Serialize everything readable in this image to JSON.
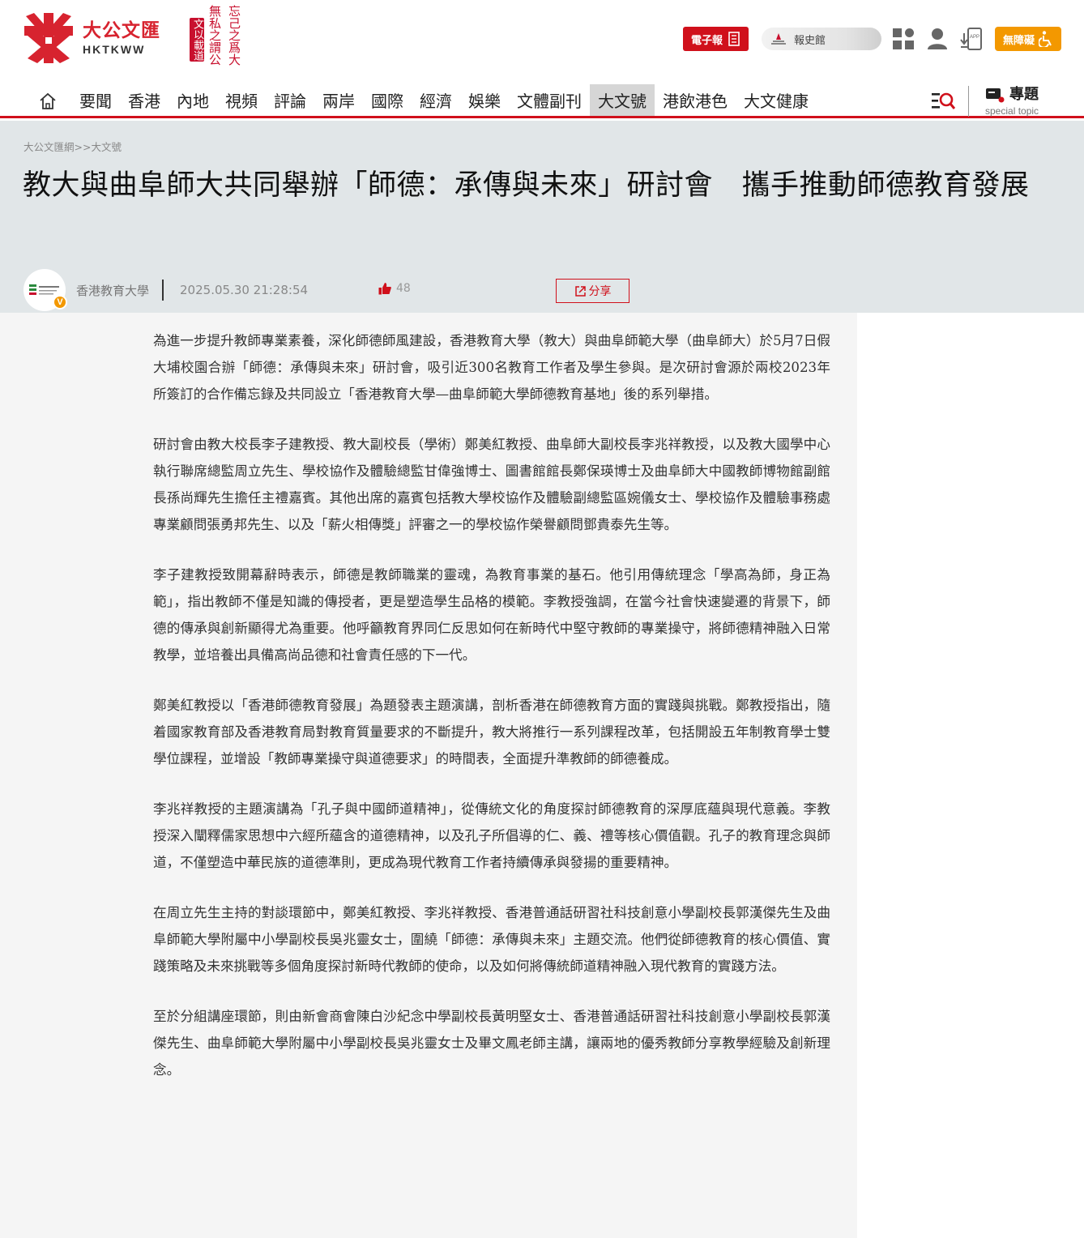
{
  "header": {
    "logo_cn": "大公文匯",
    "logo_en": "HKTKWW",
    "calligraphy": [
      "忘己之爲大",
      "無私之謂公",
      "文以載道"
    ],
    "epaper_label": "電子報",
    "archive_label": "報史館",
    "accessibility_label": "無障礙"
  },
  "nav": {
    "items": [
      {
        "label": "要聞",
        "active": false
      },
      {
        "label": "香港",
        "active": false
      },
      {
        "label": "內地",
        "active": false
      },
      {
        "label": "視頻",
        "active": false
      },
      {
        "label": "評論",
        "active": false
      },
      {
        "label": "兩岸",
        "active": false
      },
      {
        "label": "國際",
        "active": false
      },
      {
        "label": "經濟",
        "active": false
      },
      {
        "label": "娛樂",
        "active": false
      },
      {
        "label": "文體副刊",
        "active": false
      },
      {
        "label": "大文號",
        "active": true
      },
      {
        "label": "港飲港色",
        "active": false
      },
      {
        "label": "大文健康",
        "active": false
      }
    ],
    "topic_label": "專題",
    "topic_sub": "special topic"
  },
  "article": {
    "breadcrumb": "大公文匯網>>大文號",
    "title": "教大與曲阜師大共同舉辦「師德：承傳與未來」研討會　攜手推動師德教育發展",
    "author": "香港教育大學",
    "date": "2025.05.30 21:28:54",
    "likes": "48",
    "share_label": "分享",
    "paragraphs": [
      "為進一步提升教師專業素養，深化師德師風建設，香港教育大學（教大）與曲阜師範大學（曲阜師大）於5月7日假大埔校園合辦「師德：承傳與未來」研討會，吸引近300名教育工作者及學生參與。是次研討會源於兩校2023年所簽訂的合作備忘錄及共同設立「香港教育大學—曲阜師範大學師德教育基地」後的系列舉措。",
      "研討會由教大校長李子建教授、教大副校長（學術）鄭美紅教授、曲阜師大副校長李兆祥教授，以及教大國學中心執行聯席總監周立先生、學校協作及體驗總監甘偉強博士、圖書館館長鄭保瑛博士及曲阜師大中國教師博物館副館長孫尚輝先生擔任主禮嘉賓。其他出席的嘉賓包括教大學校協作及體驗副總監區婉儀女士、學校協作及體驗事務處專業顧問張勇邦先生、以及「薪火相傳獎」評審之一的學校協作榮譽顧問鄧貴泰先生等。",
      "李子建教授致開幕辭時表示，師德是教師職業的靈魂，為教育事業的基石。他引用傳統理念「學高為師，身正為範」，指出教師不僅是知識的傳授者，更是塑造學生品格的模範。李教授強調，在當今社會快速變遷的背景下，師德的傳承與創新顯得尤為重要。他呼籲教育界同仁反思如何在新時代中堅守教師的專業操守，將師德精神融入日常教學，並培養出具備高尚品德和社會責任感的下一代。",
      "鄭美紅教授以「香港師德教育發展」為題發表主題演講，剖析香港在師德教育方面的實踐與挑戰。鄭教授指出，隨着國家教育部及香港教育局對教育質量要求的不斷提升，教大將推行一系列課程改革，包括開設五年制教育學士雙學位課程，並增設「教師專業操守與道德要求」的時間表，全面提升準教師的師德養成。",
      "李兆祥教授的主題演講為「孔子與中國師道精神」，從傳統文化的角度探討師德教育的深厚底蘊與現代意義。李教授深入闡釋儒家思想中六經所蘊含的道德精神，以及孔子所倡導的仁、義、禮等核心價值觀。孔子的教育理念與師道，不僅塑造中華民族的道德準則，更成為現代教育工作者持續傳承與發揚的重要精神。",
      "在周立先生主持的對談環節中，鄭美紅教授、李兆祥教授、香港普通話研習社科技創意小學副校長郭漢傑先生及曲阜師範大學附屬中小學副校長吳兆靈女士，圍繞「師德：承傳與未來」主題交流。他們從師德教育的核心價值、實踐策略及未來挑戰等多個角度探討新時代教師的使命，以及如何將傳統師道精神融入現代教育的實踐方法。",
      "至於分組講座環節，則由新會商會陳白沙紀念中學副校長黃明堅女士、香港普通話研習社科技創意小學副校長郭漢傑先生、曲阜師範大學附屬中小學副校長吳兆靈女士及畢文鳳老師主講，讓兩地的優秀教師分享教學經驗及創新理念。"
    ]
  },
  "colors": {
    "brand_red": "#d0101b",
    "accessibility_orange": "#f39800",
    "header_band": "#e1e6e8",
    "article_bg": "#f5f5f5"
  },
  "icons": {
    "home": "home-icon",
    "search": "search-list-icon",
    "apps": "grid-icon",
    "user": "user-icon",
    "app_download": "app-download-icon",
    "topic": "topic-icon",
    "like": "thumbs-up-icon",
    "share": "share-icon",
    "accessibility": "wheelchair-icon"
  }
}
